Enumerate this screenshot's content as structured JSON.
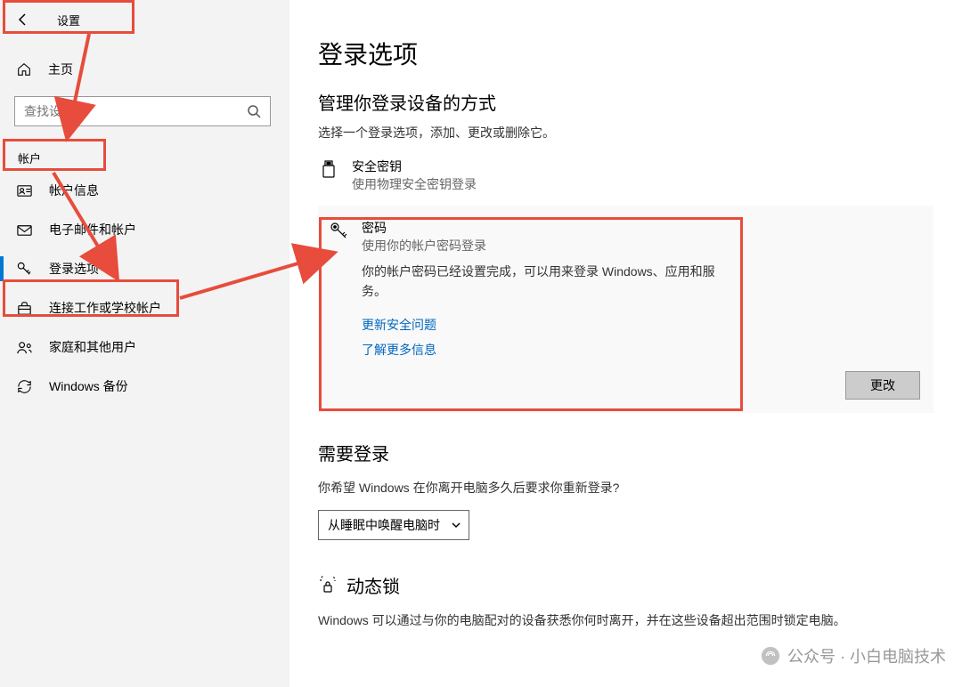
{
  "header": {
    "back_title": "设置"
  },
  "sidebar": {
    "home": "主页",
    "search_placeholder": "查找设置",
    "section": "帐户",
    "items": [
      {
        "label": "帐户信息"
      },
      {
        "label": "电子邮件和帐户"
      },
      {
        "label": "登录选项"
      },
      {
        "label": "连接工作或学校帐户"
      },
      {
        "label": "家庭和其他用户"
      },
      {
        "label": "Windows 备份"
      }
    ]
  },
  "main": {
    "title": "登录选项",
    "manage_title": "管理你登录设备的方式",
    "manage_desc": "选择一个登录选项，添加、更改或删除它。",
    "security_key": {
      "title": "安全密钥",
      "desc": "使用物理安全密钥登录"
    },
    "password": {
      "title": "密码",
      "desc": "使用你的帐户密码登录",
      "detail": "你的帐户密码已经设置完成，可以用来登录 Windows、应用和服务。",
      "link1": "更新安全问题",
      "link2": "了解更多信息",
      "change_btn": "更改"
    },
    "require_signin": {
      "title": "需要登录",
      "desc": "你希望 Windows 在你离开电脑多久后要求你重新登录?",
      "dropdown": "从睡眠中唤醒电脑时"
    },
    "dynamic_lock": {
      "title": "动态锁",
      "desc": "Windows 可以通过与你的电脑配对的设备获悉你何时离开，并在这些设备超出范围时锁定电脑。"
    }
  },
  "watermark": "公众号 · 小白电脑技术"
}
